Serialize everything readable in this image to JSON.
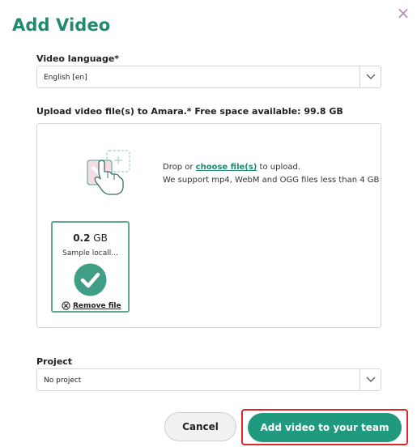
{
  "dialog": {
    "title": "Add Video",
    "close_glyph": "×"
  },
  "video_language": {
    "label": "Video language*",
    "value": "English [en]"
  },
  "upload": {
    "label": "Upload video file(s) to Amara.* Free space available: 99.8 GB",
    "drop_prefix": "Drop or ",
    "choose_link": "choose file(s)",
    "drop_suffix": " to upload.",
    "support_text": "We support mp4, WebM and OGG files less than 4 GB",
    "file": {
      "size_value": "0.2",
      "size_unit": "GB",
      "name": "Sample locall...",
      "remove_label": "Remove file"
    }
  },
  "project": {
    "label": "Project",
    "value": "No project"
  },
  "buttons": {
    "cancel": "Cancel",
    "add": "Add video to your team"
  },
  "colors": {
    "accent": "#1f8a6d",
    "primary_button": "#1f9a7e",
    "highlight": "#d82a2a"
  }
}
